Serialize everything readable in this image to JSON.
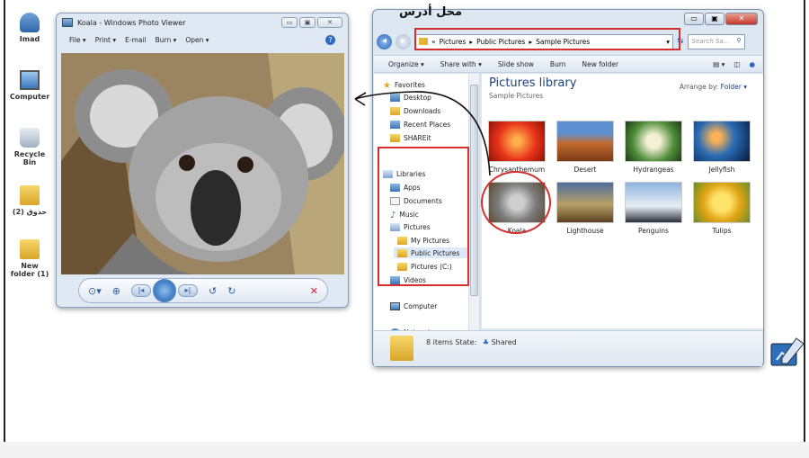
{
  "desktop": {
    "icons": [
      {
        "label": "Imad"
      },
      {
        "label": "Computer"
      },
      {
        "label": "Recycle Bin"
      },
      {
        "label": "حدوق (2)"
      },
      {
        "label": "New folder (1)"
      }
    ]
  },
  "photo_viewer": {
    "title": "Koala - Windows Photo Viewer",
    "menu": [
      "File ▾",
      "Print ▾",
      "E-mail",
      "Burn ▾",
      "Open ▾"
    ],
    "help": "?"
  },
  "explorer": {
    "annotation": "محل أدرس",
    "address": {
      "prefix": "«",
      "crumbs": [
        "Pictures",
        "Public Pictures",
        "Sample Pictures"
      ],
      "search_placeholder": "Search Sa..."
    },
    "toolbar": [
      "Organize ▾",
      "Share with ▾",
      "Slide show",
      "Burn",
      "New folder"
    ],
    "nav": {
      "favorites": "Favorites",
      "favorites_items": [
        "Desktop",
        "Downloads",
        "Recent Places",
        "SHAREit"
      ],
      "libraries": "Libraries",
      "library_items": [
        "Apps",
        "Documents",
        "Music",
        "Pictures"
      ],
      "pictures_items": [
        "My Pictures",
        "Public Pictures",
        "Pictures (C:)"
      ],
      "videos": "Videos",
      "computer": "Computer",
      "network": "Network"
    },
    "content": {
      "title": "Pictures library",
      "subtitle": "Sample Pictures",
      "arrange_label": "Arrange by:",
      "arrange_value": "Folder ▾",
      "thumbnails": [
        "Chrysanthemum",
        "Desert",
        "Hydrangeas",
        "Jellyfish",
        "Koala",
        "Lighthouse",
        "Penguins",
        "Tulips"
      ]
    },
    "details": {
      "count": "8 items",
      "state_label": "State:",
      "state_value": "Shared"
    }
  }
}
